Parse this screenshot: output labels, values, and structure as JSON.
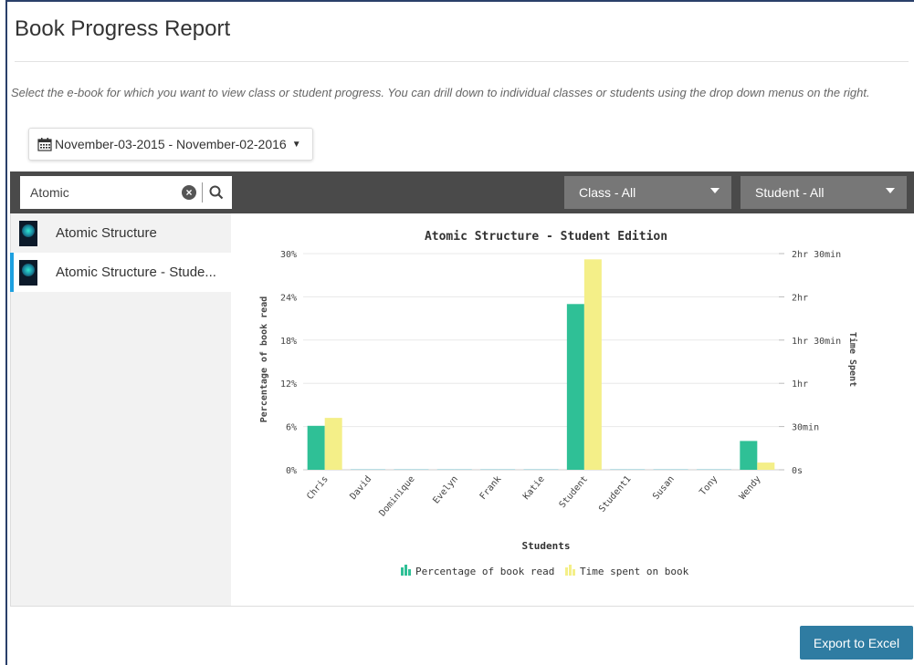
{
  "page": {
    "title": "Book Progress Report",
    "description": "Select the e-book for which you want to view class or student progress. You can drill down to individual classes or students using the drop down menus on the right."
  },
  "date_range": {
    "label": "November-03-2015 - November-02-2016"
  },
  "search": {
    "value": "Atomic"
  },
  "filters": {
    "class_label": "Class - All",
    "student_label": "Student - All"
  },
  "books": [
    {
      "label": "Atomic Structure",
      "active": false
    },
    {
      "label": "Atomic Structure - Stude...",
      "active": true
    }
  ],
  "export": {
    "label": "Export to Excel"
  },
  "colors": {
    "percent": "#2fc096",
    "time": "#f4ef88",
    "accent": "#1ea0e0",
    "export": "#2f7ca2"
  },
  "chart_data": {
    "type": "bar",
    "title": "Atomic Structure - Student Edition",
    "xlabel": "Students",
    "ylabel_left": "Percentage of book read",
    "ylabel_right": "Time Spent",
    "categories": [
      "Chris",
      "David",
      "Dominique",
      "Evelyn",
      "Frank",
      "Katie",
      "Student",
      "Student1",
      "Susan",
      "Tony",
      "Wendy"
    ],
    "left_ticks": [
      "0%",
      "6%",
      "12%",
      "18%",
      "24%",
      "30%"
    ],
    "right_ticks": [
      "0s",
      "30min",
      "1hr",
      "1hr 30min",
      "2hr",
      "2hr 30min"
    ],
    "ylim_left": [
      0,
      30
    ],
    "ylim_right_minutes": [
      0,
      150
    ],
    "grid": true,
    "legend_position": "bottom",
    "series": [
      {
        "name": "Percentage of book read",
        "axis": "left",
        "unit": "%",
        "values": [
          6.1,
          0,
          0,
          0,
          0,
          0,
          23,
          0,
          0,
          0,
          4
        ]
      },
      {
        "name": "Time spent on book",
        "axis": "right",
        "unit": "minutes",
        "values": [
          36,
          0,
          0,
          0,
          0,
          0,
          146,
          0,
          0,
          0,
          5
        ]
      }
    ]
  }
}
